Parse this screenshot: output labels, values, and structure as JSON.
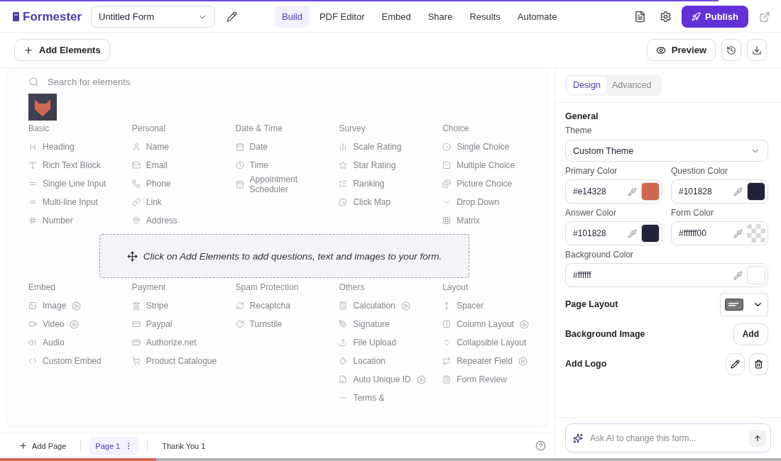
{
  "top_progress": {
    "level": 0.92
  },
  "header": {
    "brand": "Formester",
    "form_name": "Untitled Form",
    "nav": [
      {
        "label": "Build",
        "selected": true
      },
      {
        "label": "PDF Editor",
        "selected": false
      },
      {
        "label": "Embed",
        "selected": false
      },
      {
        "label": "Share",
        "selected": false
      },
      {
        "label": "Results",
        "selected": false
      },
      {
        "label": "Automate",
        "selected": false
      }
    ],
    "publish": "Publish"
  },
  "toolbar": {
    "add_elements": "Add Elements",
    "preview": "Preview"
  },
  "palette": {
    "search_placeholder": "Search for elements",
    "top_sections": [
      {
        "title": "Basic",
        "items": [
          {
            "label": "Heading",
            "video": false
          },
          {
            "label": "Rich Text Block",
            "video": false
          },
          {
            "label": "Single Line Input",
            "video": false
          },
          {
            "label": "Multi-line Input",
            "video": false
          },
          {
            "label": "Number",
            "video": false
          }
        ]
      },
      {
        "title": "Personal",
        "items": [
          {
            "label": "Name",
            "video": false
          },
          {
            "label": "Email",
            "video": false
          },
          {
            "label": "Phone",
            "video": false
          },
          {
            "label": "Link",
            "video": false
          },
          {
            "label": "Address",
            "video": false
          }
        ]
      },
      {
        "title": "Date & Time",
        "items": [
          {
            "label": "Date",
            "video": false
          },
          {
            "label": "Time",
            "video": false
          },
          {
            "label": "Appointment Scheduler",
            "video": false
          }
        ]
      },
      {
        "title": "Survey",
        "items": [
          {
            "label": "Scale Rating",
            "video": false
          },
          {
            "label": "Star Rating",
            "video": false
          },
          {
            "label": "Ranking",
            "video": false
          },
          {
            "label": "Click Map",
            "video": false
          }
        ]
      },
      {
        "title": "Choice",
        "items": [
          {
            "label": "Single Choice",
            "video": false
          },
          {
            "label": "Multiple Choice",
            "video": false
          },
          {
            "label": "Picture Choice",
            "video": false
          },
          {
            "label": "Drop Down",
            "video": false
          },
          {
            "label": "Matrix",
            "video": false
          }
        ]
      }
    ],
    "bottom_sections": [
      {
        "title": "Embed",
        "items": [
          {
            "label": "Image",
            "video": true
          },
          {
            "label": "Video",
            "video": true
          },
          {
            "label": "Audio",
            "video": false
          },
          {
            "label": "Custom Embed",
            "video": false
          }
        ]
      },
      {
        "title": "Payment",
        "items": [
          {
            "label": "Stripe",
            "video": false
          },
          {
            "label": "Paypal",
            "video": false
          },
          {
            "label": "Authorize.net",
            "video": false
          },
          {
            "label": "Product Catalogue",
            "video": false
          }
        ]
      },
      {
        "title": "Spam Protection",
        "items": [
          {
            "label": "Recaptcha",
            "video": false
          },
          {
            "label": "Turnstile",
            "video": false
          }
        ]
      },
      {
        "title": "Others",
        "items": [
          {
            "label": "Calculation",
            "video": true
          },
          {
            "label": "Signature",
            "video": false
          },
          {
            "label": "File Upload",
            "video": false
          },
          {
            "label": "Location",
            "video": false
          },
          {
            "label": "Auto Unique ID",
            "video": true
          },
          {
            "label": "Terms &",
            "video": false
          }
        ]
      },
      {
        "title": "Layout",
        "items": [
          {
            "label": "Spacer",
            "video": false
          },
          {
            "label": "Column Layout",
            "video": true
          },
          {
            "label": "Collapsible Layout",
            "video": false
          },
          {
            "label": "Repeater Field",
            "video": true
          },
          {
            "label": "Form Review",
            "video": false
          }
        ]
      }
    ]
  },
  "dropzone": {
    "text": "Click on Add Elements to add questions, text and images to your form."
  },
  "panel": {
    "tabs": [
      {
        "label": "Design",
        "selected": true
      },
      {
        "label": "Advanced",
        "selected": false
      }
    ],
    "section": "General",
    "theme_label": "Theme",
    "theme_value": "Custom Theme",
    "colors": [
      {
        "label": "Primary Color",
        "value": "#e14328",
        "kind": "solid",
        "color": "#cf6a50"
      },
      {
        "label": "Question Color",
        "value": "#101828",
        "kind": "solid",
        "color": "#22223a"
      },
      {
        "label": "Answer Color",
        "value": "#101828",
        "kind": "solid",
        "color": "#22223a"
      },
      {
        "label": "Form Color",
        "value": "#ffffff00",
        "kind": "transparent"
      },
      {
        "label": "Background Color",
        "value": "#ffffff",
        "kind": "solid",
        "color": "#ffffff"
      }
    ],
    "page_layout": "Page Layout",
    "background_image": "Background Image",
    "add": "Add",
    "add_logo": "Add Logo",
    "ai_placeholder": "Ask AI to change this form..."
  },
  "footer": {
    "add_page": "Add Page",
    "pages": [
      {
        "label": "Page 1",
        "selected": true
      },
      {
        "label": "Thank You 1",
        "selected": false
      }
    ]
  },
  "bottom_progress": {
    "level": 0.2
  }
}
